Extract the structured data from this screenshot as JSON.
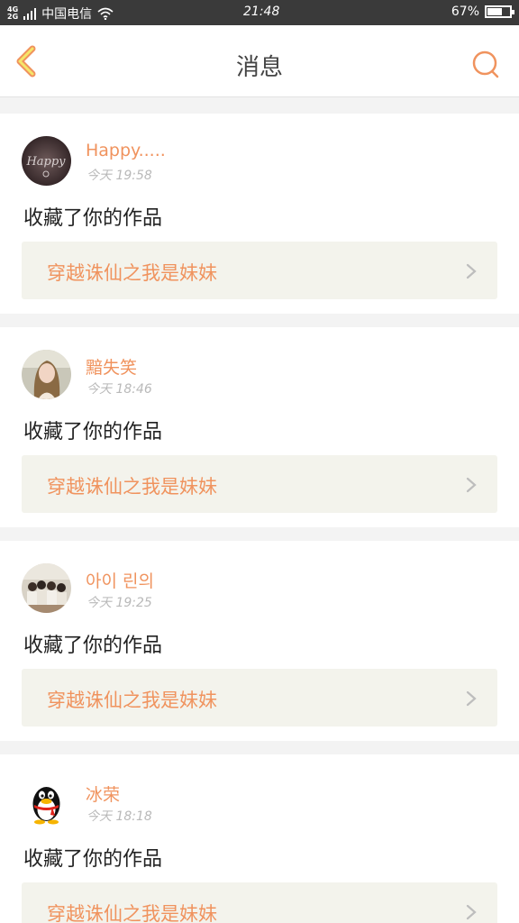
{
  "status_bar": {
    "network_top": "4G",
    "network_bottom": "2G",
    "carrier": "中国电信",
    "time": "21:48",
    "battery": "67%",
    "battery_level": 0.67,
    "icons": [
      "signal-icon",
      "wifi-icon",
      "battery-icon"
    ]
  },
  "header": {
    "title": "消息",
    "back_icon": "chevron-left-icon",
    "search_icon": "search-icon",
    "accent_color": "#f0935e"
  },
  "messages": [
    {
      "username": "Happy.....",
      "time": "今天 19:58",
      "action": "收藏了你的作品",
      "work_title": "穿越诛仙之我是妹妹"
    },
    {
      "username": "黯失笑",
      "time": "今天 18:46",
      "action": "收藏了你的作品",
      "work_title": "穿越诛仙之我是妹妹"
    },
    {
      "username": "아이 린의",
      "time": "今天 19:25",
      "action": "收藏了你的作品",
      "work_title": "穿越诛仙之我是妹妹"
    },
    {
      "username": "冰荣",
      "time": "今天 18:18",
      "action": "收藏了你的作品",
      "work_title": "穿越诛仙之我是妹妹"
    }
  ]
}
